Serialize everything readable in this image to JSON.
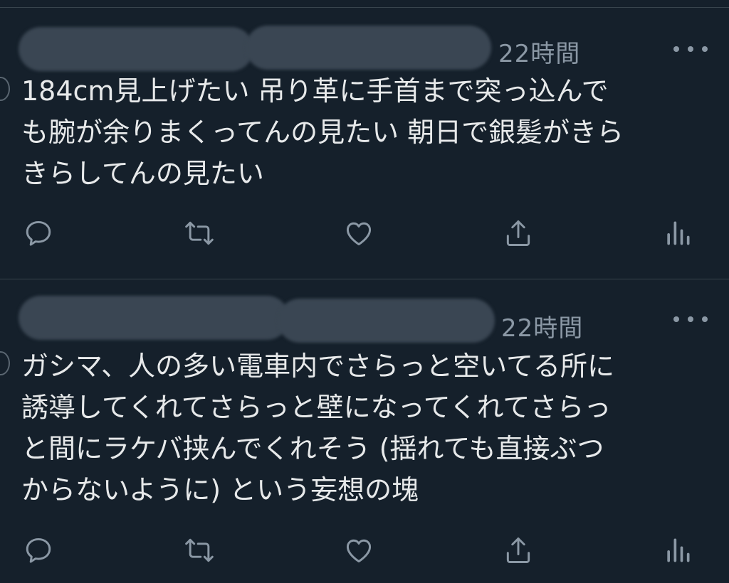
{
  "tweets": [
    {
      "time": "22時間",
      "text": "184cm見上げたい 吊り革に手首まで突っ込んで\nも腕が余りまくってんの見たい 朝日で銀髪がきら\nきらしてんの見たい"
    },
    {
      "time": "22時間",
      "text": "ガシマ、人の多い電車内でさらっと空いてる所に\n誘導してくれてさらっと壁になってくれてさらっ\nと間にラケバ挟んでくれそう (揺れても直接ぶつ\nからないように) という妄想の塊"
    }
  ],
  "icons": {
    "reply": "speech-bubble-icon",
    "retweet": "retweet-icon",
    "like": "heart-icon",
    "share": "share-icon",
    "analytics": "bar-chart-icon",
    "more": "ellipsis-icon"
  },
  "colors": {
    "background": "#15202b",
    "text": "#e7e9ea",
    "secondary": "#8b98a5",
    "divider": "#38444d"
  }
}
